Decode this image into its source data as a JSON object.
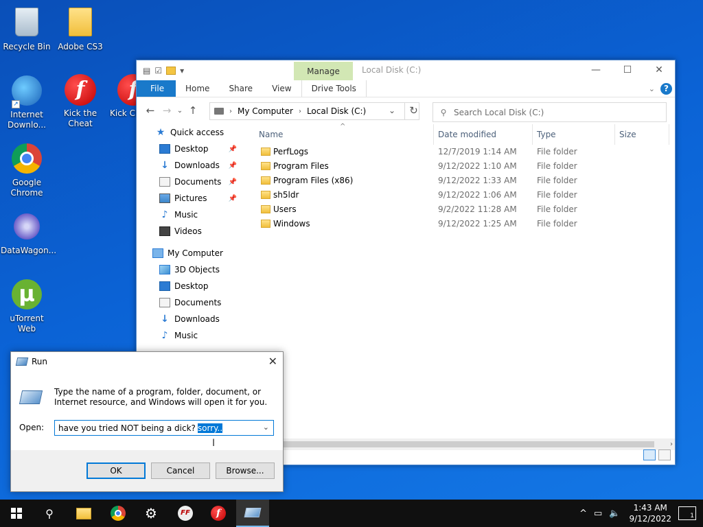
{
  "desktop": {
    "icons": [
      {
        "label": "Recycle Bin"
      },
      {
        "label": "Adobe CS3"
      },
      {
        "label": "Internet Downlo..."
      },
      {
        "label": "Kick the Cheat"
      },
      {
        "label": "Kick Cheat_..."
      },
      {
        "label": "Google Chrome"
      },
      {
        "label": "DataWagon..."
      },
      {
        "label": "uTorrent Web"
      }
    ]
  },
  "explorer": {
    "title": "Local Disk (C:)",
    "manage_tab": "Manage",
    "ribbon_tabs": [
      "File",
      "Home",
      "Share",
      "View",
      "Drive Tools"
    ],
    "address": [
      "My Computer",
      "Local Disk (C:)"
    ],
    "search_placeholder": "Search Local Disk (C:)",
    "columns": {
      "name": "Name",
      "date": "Date modified",
      "type": "Type",
      "size": "Size"
    },
    "nav": {
      "quick_access": "Quick access",
      "quick_items": [
        "Desktop",
        "Downloads",
        "Documents",
        "Pictures",
        "Music",
        "Videos"
      ],
      "my_computer": "My Computer",
      "pc_items": [
        "3D Objects",
        "Desktop",
        "Documents",
        "Downloads",
        "Music"
      ]
    },
    "files": [
      {
        "name": "PerfLogs",
        "date": "12/7/2019 1:14 AM",
        "type": "File folder"
      },
      {
        "name": "Program Files",
        "date": "9/12/2022 1:10 AM",
        "type": "File folder"
      },
      {
        "name": "Program Files (x86)",
        "date": "9/12/2022 1:33 AM",
        "type": "File folder"
      },
      {
        "name": "sh5ldr",
        "date": "9/12/2022 1:06 AM",
        "type": "File folder"
      },
      {
        "name": "Users",
        "date": "9/2/2022 11:28 AM",
        "type": "File folder"
      },
      {
        "name": "Windows",
        "date": "9/12/2022 1:25 AM",
        "type": "File folder"
      }
    ]
  },
  "run": {
    "title": "Run",
    "description": "Type the name of a program, folder, document, or Internet resource, and Windows will open it for you.",
    "open_label": "Open:",
    "typed_text": "have you tried NOT being a dick?",
    "selected_text": "sorry..",
    "ok_label": "OK",
    "cancel_label": "Cancel",
    "browse_label": "Browse..."
  },
  "taskbar": {
    "time": "1:43 AM",
    "date": "9/12/2022",
    "notification_count": "1"
  }
}
